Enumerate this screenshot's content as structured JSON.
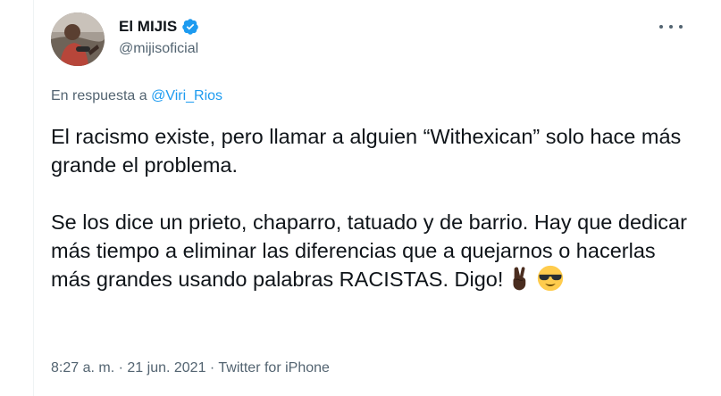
{
  "user": {
    "display_name": "El MIJIS",
    "handle": "@mijisoficial",
    "verified": true
  },
  "reply": {
    "prefix": "En respuesta a",
    "to": "@Viri_Rios"
  },
  "tweet": {
    "paragraph1": "El racismo existe, pero llamar a alguien “Withexican” solo hace más grande el problema.",
    "paragraph2": "Se los dice un prieto, chaparro, tatuado y de barrio. Hay que dedicar más tiempo a eliminar las diferencias que a quejarnos o hacerlas más grandes usando palabras RACISTAS. Digo!",
    "emojis": [
      "victory-hand-dark-skin-tone",
      "smiling-face-with-sunglasses"
    ]
  },
  "meta": {
    "time": "8:27 a. m.",
    "separator": "·",
    "date": "21 jun. 2021",
    "source": "Twitter for iPhone"
  },
  "colors": {
    "text": "#0f1419",
    "secondary": "#536471",
    "link": "#1d9bf0",
    "verified": "#1d9bf0"
  },
  "icons": {
    "verified": "verified-badge-icon",
    "more": "more-options-icon"
  }
}
